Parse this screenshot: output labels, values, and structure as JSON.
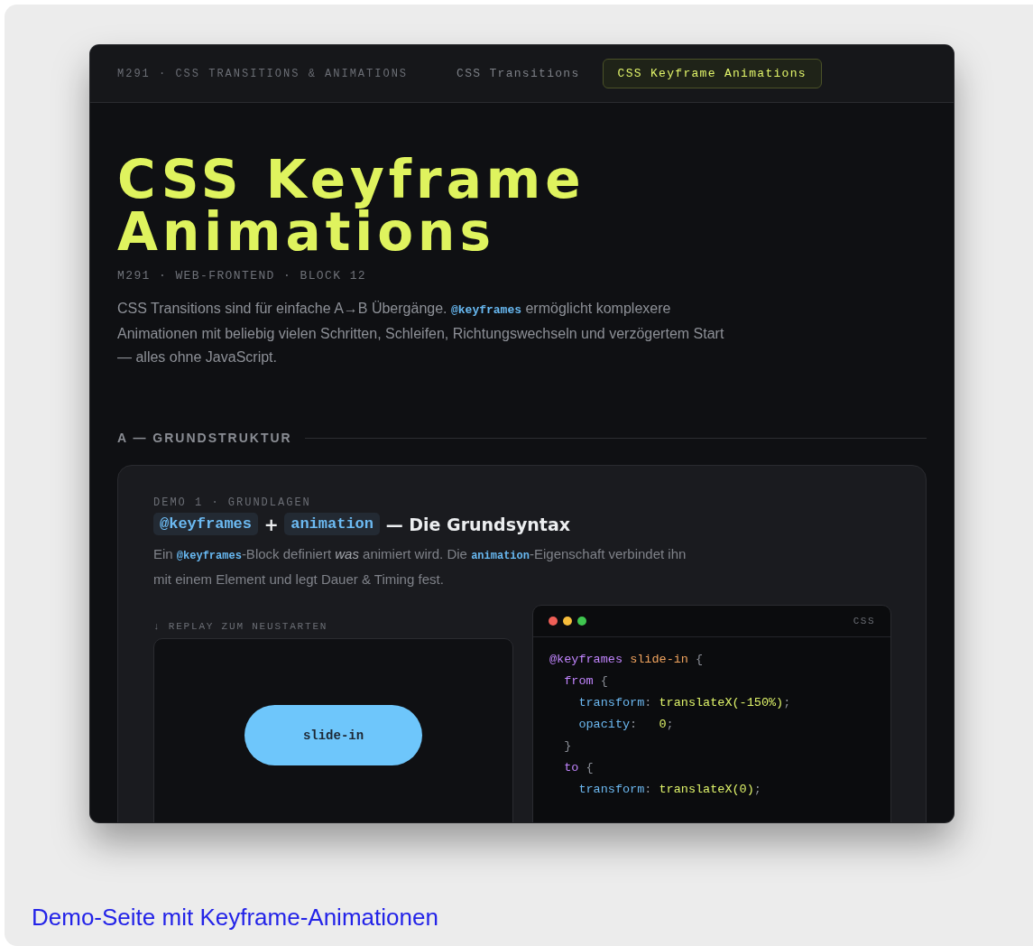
{
  "nav": {
    "brand": "M291 · CSS TRANSITIONS & ANIMATIONS",
    "tabs": [
      {
        "label": "CSS Transitions",
        "selected": false
      },
      {
        "label": "CSS Keyframe Animations",
        "selected": true
      }
    ]
  },
  "hero": {
    "title_lines": [
      "CSS Keyframe",
      "Animations"
    ],
    "meta": "M291 · WEB-FRONTEND · BLOCK 12",
    "intro": [
      {
        "kind": "text",
        "text": "CSS Transitions sind für einfache A→B Übergänge. "
      },
      {
        "kind": "code",
        "text": "@keyframes"
      },
      {
        "kind": "text",
        "text": " ermöglicht komplexere Animationen mit beliebig vielen Schritten, Schleifen, Richtungswechseln und verzögertem Start — alles ohne JavaScript."
      }
    ]
  },
  "section": {
    "heading": "A — GRUNDSTRUKTUR",
    "card": {
      "eyebrow": "DEMO 1 · GRUNDLAGEN",
      "title": [
        {
          "kind": "code",
          "text": "@keyframes"
        },
        {
          "kind": "text",
          "text": " + "
        },
        {
          "kind": "code",
          "text": "animation"
        },
        {
          "kind": "text",
          "text": " — Die Grundsyntax"
        }
      ],
      "description": [
        {
          "kind": "text",
          "text": "Ein "
        },
        {
          "kind": "code",
          "text": "@keyframes"
        },
        {
          "kind": "text",
          "text": "-Block definiert "
        },
        {
          "kind": "em",
          "text": "was"
        },
        {
          "kind": "text",
          "text": " animiert wird. Die "
        },
        {
          "kind": "code",
          "text": "animation"
        },
        {
          "kind": "text",
          "text": "-Eigenschaft verbindet ihn mit einem Element und legt Dauer & Timing fest."
        }
      ],
      "replay_label": "↓ REPLAY ZUM NEUSTARTEN",
      "demo_pill": "slide-in",
      "code": {
        "language": "CSS",
        "lines": [
          {
            "tokens": [
              {
                "kind": "keyword",
                "text": "@keyframes "
              },
              {
                "kind": "name",
                "text": "slide-in"
              },
              {
                "kind": "punct",
                "text": " {"
              }
            ],
            "children": [
              {
                "tokens": [
                  {
                    "kind": "keyword",
                    "text": "from"
                  },
                  {
                    "kind": "punct",
                    "text": " {"
                  }
                ],
                "children": [
                  {
                    "tokens": [
                      {
                        "kind": "prop",
                        "text": "transform"
                      },
                      {
                        "kind": "punct",
                        "text": ": "
                      },
                      {
                        "kind": "value",
                        "text": "translateX(-150%)"
                      },
                      {
                        "kind": "punct",
                        "text": ";"
                      }
                    ]
                  },
                  {
                    "tokens": [
                      {
                        "kind": "prop",
                        "text": "opacity"
                      },
                      {
                        "kind": "punct",
                        "text": ":   "
                      },
                      {
                        "kind": "value",
                        "text": "0"
                      },
                      {
                        "kind": "punct",
                        "text": ";"
                      }
                    ]
                  }
                ]
              },
              {
                "tokens": [
                  {
                    "kind": "punct",
                    "text": "}"
                  }
                ]
              },
              {
                "tokens": [
                  {
                    "kind": "keyword",
                    "text": "to"
                  },
                  {
                    "kind": "punct",
                    "text": " {"
                  }
                ],
                "children": [
                  {
                    "tokens": [
                      {
                        "kind": "prop",
                        "text": "transform"
                      },
                      {
                        "kind": "punct",
                        "text": ": "
                      },
                      {
                        "kind": "value",
                        "text": "translateX(0)"
                      },
                      {
                        "kind": "punct",
                        "text": ";"
                      }
                    ]
                  }
                ]
              }
            ]
          }
        ]
      }
    }
  },
  "caption": "Demo-Seite mit Keyframe-Animationen"
}
